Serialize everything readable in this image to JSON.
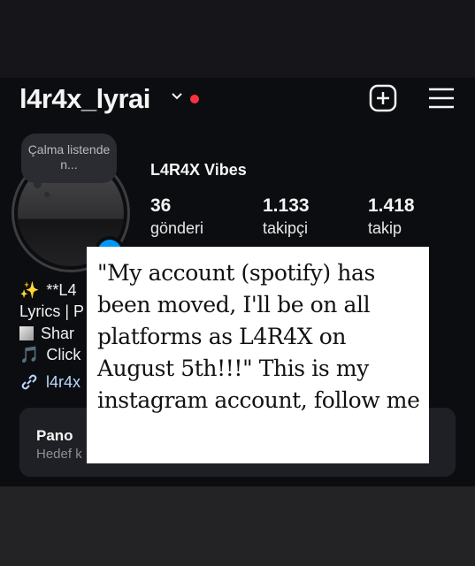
{
  "header": {
    "username": "l4r4x_lyrai",
    "icons": [
      "chevron-down-icon",
      "notification-dot",
      "create-plus-icon",
      "hamburger-menu-icon"
    ],
    "notification_color": "#ff3040"
  },
  "profile": {
    "note": "Çalma listende n...",
    "display_name": "L4R4X Vibes",
    "stats": [
      {
        "value": "36",
        "label": "gönderi"
      },
      {
        "value": "1.133",
        "label": "takipçi"
      },
      {
        "value": "1.418",
        "label": "takip"
      }
    ],
    "bio_lines": [
      "**L4",
      "Lyrics | P",
      "Shar",
      "Click"
    ],
    "link": "l4r4x",
    "accent": "#0095f6"
  },
  "dashboard": {
    "title": "Pano",
    "subtitle": "Hedef k"
  },
  "caption": {
    "text": "\"My account (spotify) has been moved, I'll be on all platforms as L4R4X on August 5th!!!\" This is my instagram account, follow me"
  }
}
